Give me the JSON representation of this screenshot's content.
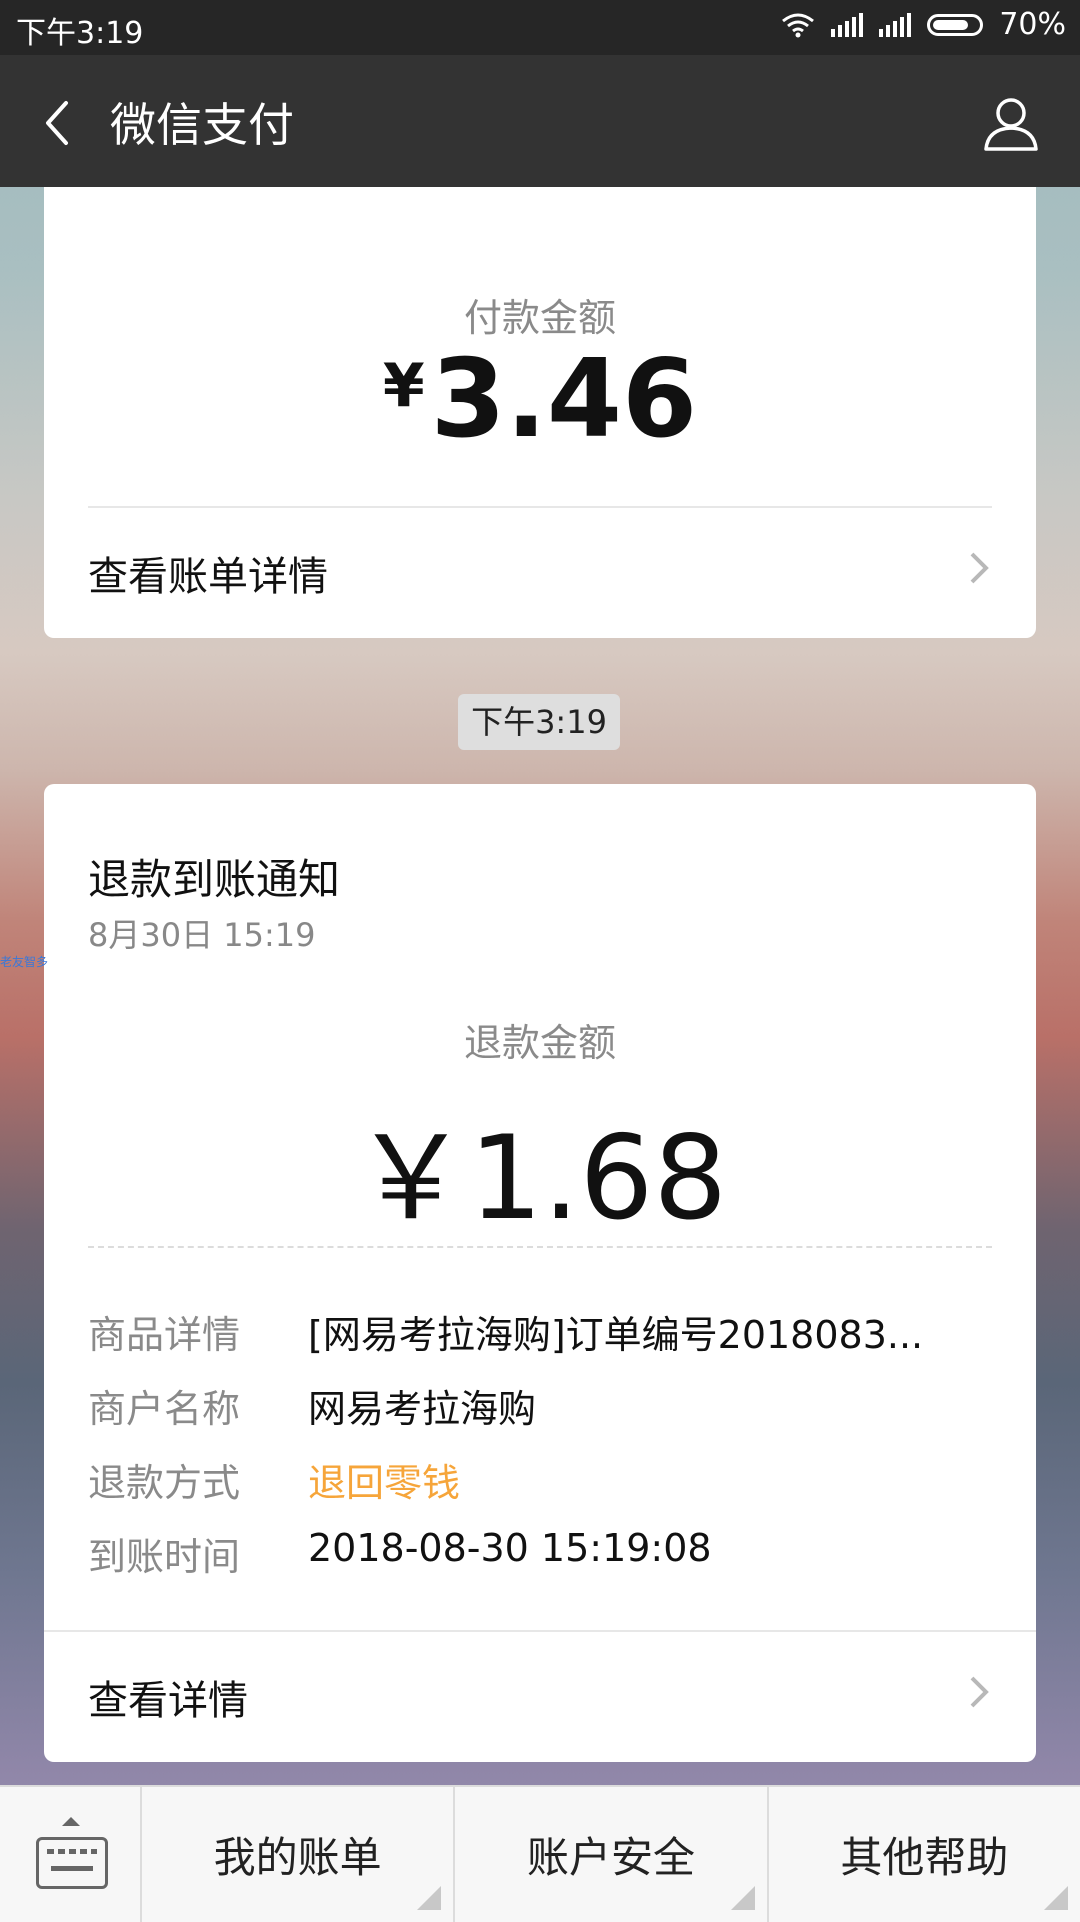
{
  "status_bar": {
    "time": "下午3:19",
    "battery": "70%"
  },
  "header": {
    "title": "微信支付"
  },
  "payment_card": {
    "label": "付款金额",
    "currency": "¥",
    "amount": "3.46",
    "link": "查看账单详情"
  },
  "time_pill": "下午3:19",
  "refund_card": {
    "title": "退款到账通知",
    "date": "8月30日  15:19",
    "amount_label": "退款金额",
    "amount": "￥1.68",
    "details": [
      {
        "key": "商品详情",
        "value": "[网易考拉海购]订单编号2018083..."
      },
      {
        "key": "商户名称",
        "value": "网易考拉海购"
      },
      {
        "key": "退款方式",
        "value": "退回零钱"
      },
      {
        "key": "到账时间",
        "value": "2018-08-30 15:19:08"
      }
    ],
    "link": "查看详情"
  },
  "side_text": "老友智多",
  "bottom_menu": [
    "我的账单",
    "账户安全",
    "其他帮助"
  ],
  "colors": {
    "status_bar": "#262626",
    "header": "#333333",
    "refund_method": "#f6a53a"
  }
}
